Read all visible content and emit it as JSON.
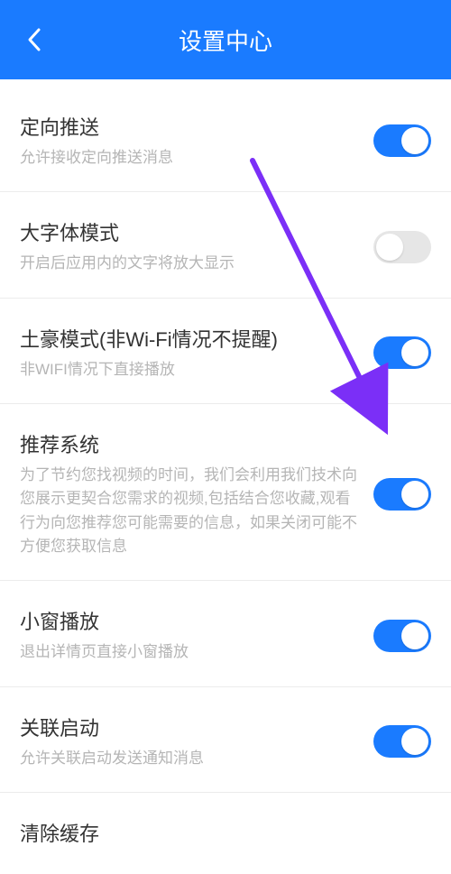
{
  "header": {
    "title": "设置中心"
  },
  "settings": [
    {
      "key": "push",
      "title": "定向推送",
      "desc": "允许接收定向推送消息",
      "enabled": true
    },
    {
      "key": "bigfont",
      "title": "大字体模式",
      "desc": "开启后应用内的文字将放大显示",
      "enabled": false
    },
    {
      "key": "tuhao",
      "title": "土豪模式(非Wi-Fi情况不提醒)",
      "desc": "非WIFI情况下直接播放",
      "enabled": true
    },
    {
      "key": "recommend",
      "title": "推荐系统",
      "desc": "为了节约您找视频的时间，我们会利用我们技术向您展示更契合您需求的视频,包括结合您收藏,观看行为向您推荐您可能需要的信息，如果关闭可能不方便您获取信息",
      "enabled": true
    },
    {
      "key": "pip",
      "title": "小窗播放",
      "desc": "退出详情页直接小窗播放",
      "enabled": true
    },
    {
      "key": "assoc",
      "title": "关联启动",
      "desc": "允许关联启动发送通知消息",
      "enabled": true
    },
    {
      "key": "cache",
      "title": "清除缓存",
      "desc": "",
      "enabled": null
    }
  ],
  "annotation": {
    "arrow_color": "#7b2ff7"
  }
}
